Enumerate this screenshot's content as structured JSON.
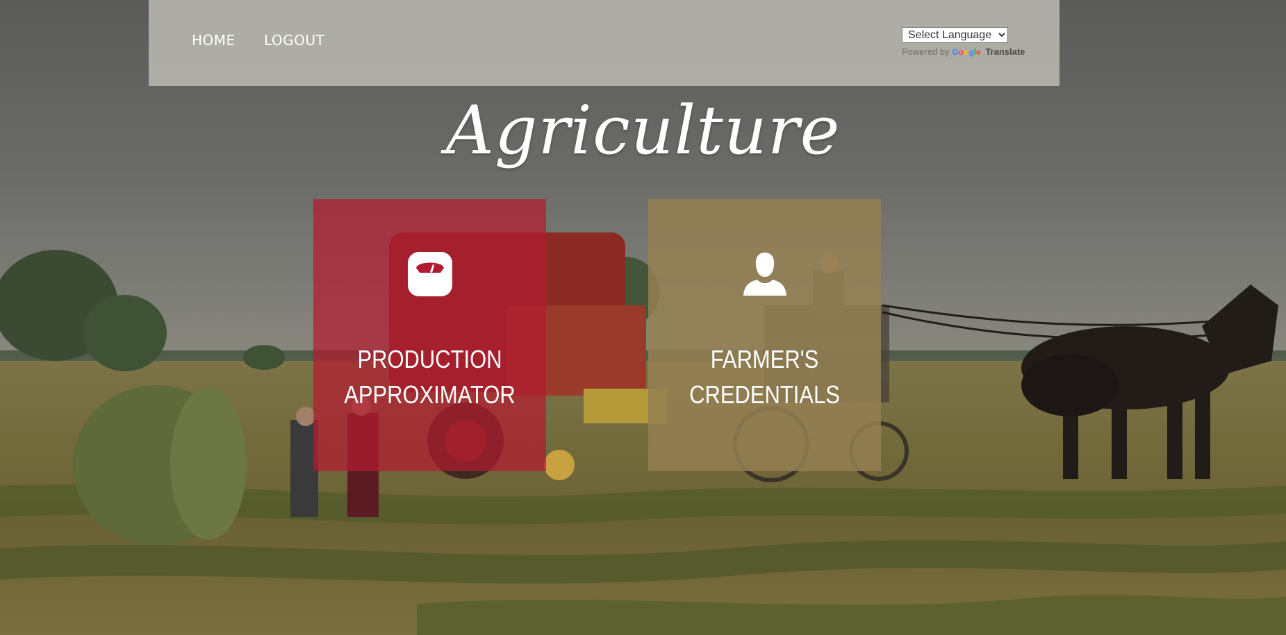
{
  "nav": {
    "home_label": "HOME",
    "logout_label": "LOGOUT"
  },
  "translate": {
    "select_label": "Select Language",
    "powered_by": "Powered by",
    "google_letters": [
      "G",
      "o",
      "o",
      "g",
      "l",
      "e"
    ],
    "google_colors": [
      "#4285f4",
      "#ea4335",
      "#fbbc05",
      "#4285f4",
      "#34a853",
      "#ea4335"
    ],
    "translate_word": "Translate"
  },
  "page": {
    "title": "Agriculture"
  },
  "tiles": {
    "production": {
      "line1": "PRODUCTION",
      "line2": "APPROXIMATOR",
      "icon": "weighing-scale-icon",
      "color": "#b21c30"
    },
    "credentials": {
      "line1": "FARMER'S",
      "line2": "CREDENTIALS",
      "icon": "user-icon",
      "color": "#948052"
    }
  }
}
